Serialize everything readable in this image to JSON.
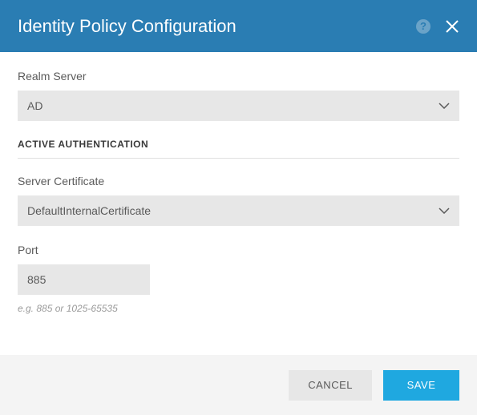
{
  "header": {
    "title": "Identity Policy Configuration"
  },
  "fields": {
    "realm_server": {
      "label": "Realm Server",
      "value": "AD"
    },
    "section_heading": "ACTIVE AUTHENTICATION",
    "server_certificate": {
      "label": "Server Certificate",
      "value": "DefaultInternalCertificate"
    },
    "port": {
      "label": "Port",
      "value": "885",
      "hint": "e.g. 885 or 1025-65535"
    }
  },
  "footer": {
    "cancel": "CANCEL",
    "save": "SAVE"
  }
}
